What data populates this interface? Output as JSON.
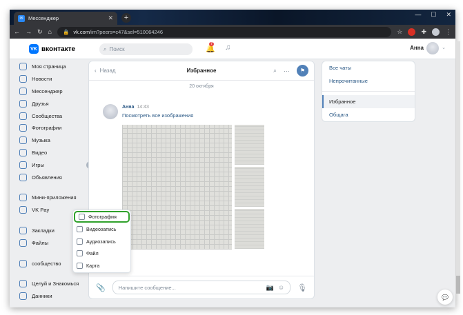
{
  "browser": {
    "tab_title": "Мессенджер",
    "url_host": "vk.com",
    "url_path": "/im?peers=c47&sel=510064246"
  },
  "header": {
    "logo_text": "вконтакте",
    "search_placeholder": "Поиск",
    "notifications_count": "7",
    "user_name": "Анна"
  },
  "sidebar": {
    "items": [
      {
        "label": "Моя страница",
        "icon": "user-icon"
      },
      {
        "label": "Новости",
        "icon": "news-icon"
      },
      {
        "label": "Мессенджер",
        "icon": "chat-icon"
      },
      {
        "label": "Друзья",
        "icon": "friends-icon"
      },
      {
        "label": "Сообщества",
        "icon": "groups-icon"
      },
      {
        "label": "Фотографии",
        "icon": "photo-icon"
      },
      {
        "label": "Музыка",
        "icon": "music-icon"
      },
      {
        "label": "Видео",
        "icon": "video-icon"
      },
      {
        "label": "Игры",
        "icon": "games-icon",
        "count": "1"
      },
      {
        "label": "Объявления",
        "icon": "ads-icon"
      }
    ],
    "items2": [
      {
        "label": "Мини-приложения",
        "icon": "apps-icon"
      },
      {
        "label": "VK Pay",
        "icon": "pay-icon"
      }
    ],
    "items3": [
      {
        "label": "Закладки",
        "icon": "bookmark-icon"
      },
      {
        "label": "Файлы",
        "icon": "file-icon"
      }
    ],
    "items4": [
      {
        "label": "сообщество",
        "icon": "groups-icon"
      }
    ],
    "items5": [
      {
        "label": "Целуй и Знакомься",
        "icon": "shop-icon"
      },
      {
        "label": "Данники",
        "icon": "shop-icon"
      }
    ]
  },
  "chat": {
    "back_label": "Назад",
    "title": "Избранное",
    "date": "20 октября",
    "message": {
      "author": "Анна",
      "time": "14:43",
      "link": "Посмотреть все изображения"
    },
    "composer_placeholder": "Напишите сообщение..."
  },
  "right_panel": {
    "items": [
      "Все чаты",
      "Непрочитанные"
    ],
    "items2": [
      "Избранное",
      "Общага"
    ],
    "active": "Избранное"
  },
  "attach_menu": {
    "items": [
      "Фотография",
      "Видеозапись",
      "Аудиозапись",
      "Файл",
      "Карта"
    ],
    "highlighted": "Фотография"
  },
  "colors": {
    "accent": "#5181b8",
    "highlight": "#2fa12b",
    "badge": "#e64646"
  }
}
